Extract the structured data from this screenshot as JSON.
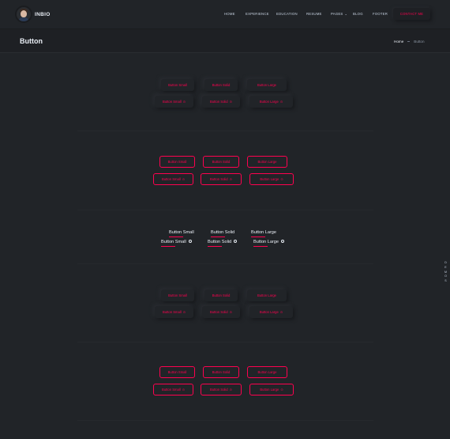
{
  "header": {
    "brand": "INBIO",
    "nav": [
      {
        "label": "HOME"
      },
      {
        "label": "EXPERIENCE"
      },
      {
        "label": "EDUCATION"
      },
      {
        "label": "RESUME"
      },
      {
        "label": "PAGES"
      },
      {
        "label": "BLOG"
      },
      {
        "label": "FOOTER"
      }
    ],
    "contact_label": "CONTACT ME"
  },
  "titlebar": {
    "title": "Button",
    "breadcrumb": {
      "home": "Home",
      "current": "Button"
    }
  },
  "sections": [
    {
      "style": "shadow",
      "row1": [
        "Button Small",
        "Button Solid",
        "Button Large"
      ],
      "row2": [
        "Button Small",
        "Button Solid",
        "Button Large"
      ]
    },
    {
      "style": "outline",
      "row1": [
        "Button Small",
        "Button Solid",
        "Button Large"
      ],
      "row2": [
        "Button Small",
        "Button Solid",
        "Button Large"
      ]
    },
    {
      "style": "text",
      "row1": [
        "Button Small",
        "Button Solid",
        "Button Large"
      ],
      "row2": [
        "Button Small",
        "Button Solid",
        "Button Large"
      ]
    },
    {
      "style": "shadow",
      "row1": [
        "Button Small",
        "Button Solid",
        "Button Large"
      ],
      "row2": [
        "Button Small",
        "Button Solid",
        "Button Large"
      ]
    },
    {
      "style": "outline",
      "row1": [
        "Button Small",
        "Button Solid",
        "Button Large"
      ],
      "row2": [
        "Button Small",
        "Button Solid",
        "Button Large"
      ]
    }
  ],
  "side_label": [
    "D",
    "E",
    "M",
    "O",
    "S"
  ],
  "colors": {
    "accent": "#ff014f",
    "background": "#212428",
    "text": "#c4cfde"
  }
}
